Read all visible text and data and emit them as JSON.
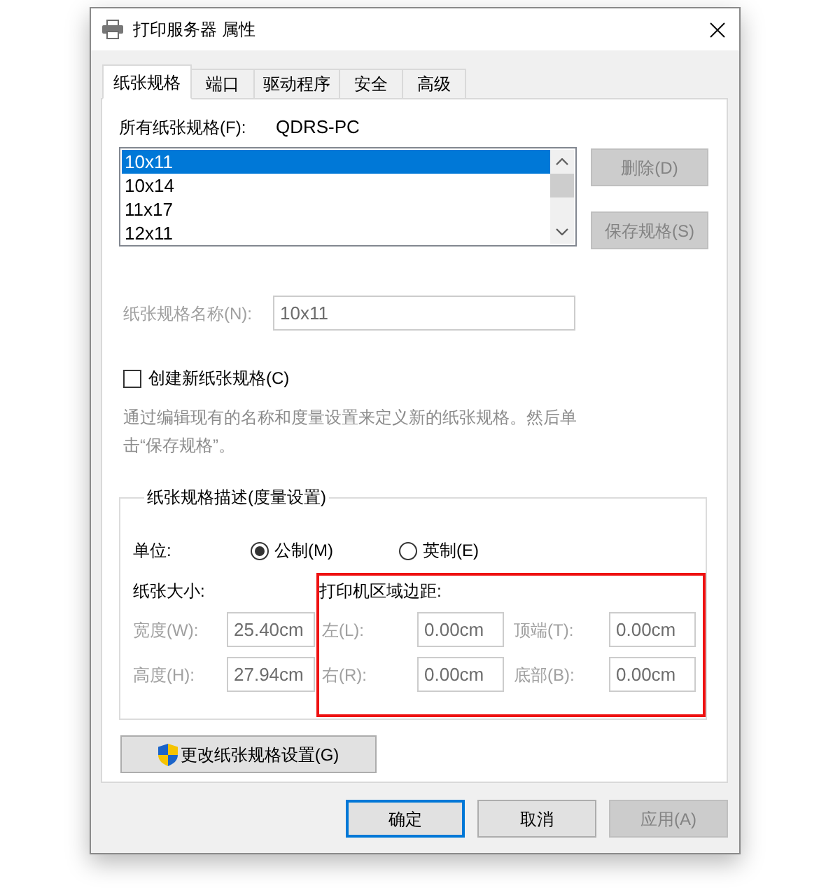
{
  "window": {
    "title": "打印服务器 属性"
  },
  "tabs": [
    {
      "label": "纸张规格",
      "selected": true
    },
    {
      "label": "端口",
      "selected": false
    },
    {
      "label": "驱动程序",
      "selected": false
    },
    {
      "label": "安全",
      "selected": false
    },
    {
      "label": "高级",
      "selected": false
    }
  ],
  "forms_list": {
    "label": "所有纸张规格(F):",
    "computer": "QDRS-PC",
    "items": [
      {
        "label": "10x11",
        "selected": true
      },
      {
        "label": "10x14",
        "selected": false
      },
      {
        "label": "11x17",
        "selected": false
      },
      {
        "label": "12x11",
        "selected": false
      }
    ]
  },
  "side_buttons": [
    {
      "label": "删除(D)",
      "disabled": true
    },
    {
      "label": "保存规格(S)",
      "disabled": true
    }
  ],
  "form_name": {
    "label": "纸张规格名称(N):",
    "value": "10x11",
    "disabled": true
  },
  "create_new_form": {
    "label": "创建新纸张规格(C)",
    "checked": false
  },
  "hint": {
    "text": "通过编辑现有的名称和度量设置来定义新的纸张规格。然后单击“保存规格”。",
    "disabled": true
  },
  "measurements": {
    "title": "纸张规格描述(度量设置)",
    "units": {
      "label": "单位:",
      "options": [
        {
          "label": "公制(M)",
          "selected": true
        },
        {
          "label": "英制(E)",
          "selected": false
        }
      ]
    },
    "paper_size": {
      "title": "纸张大小:",
      "fields": [
        {
          "label": "宽度(W):",
          "value": "25.40cm",
          "disabled": true
        },
        {
          "label": "高度(H):",
          "value": "27.94cm",
          "disabled": true
        }
      ]
    },
    "printer_margins": {
      "title": "打印机区域边距:",
      "highlighted": true,
      "fields": [
        {
          "label": "左(L):",
          "value": "0.00cm",
          "disabled": true
        },
        {
          "label": "顶端(T):",
          "value": "0.00cm",
          "disabled": true
        },
        {
          "label": "右(R):",
          "value": "0.00cm",
          "disabled": true
        },
        {
          "label": "底部(B):",
          "value": "0.00cm",
          "disabled": true
        }
      ]
    }
  },
  "change_settings_button": {
    "label": "更改纸张规格设置(G)"
  },
  "buttons": [
    {
      "label": "确定",
      "default": true,
      "disabled": false
    },
    {
      "label": "取消",
      "default": false,
      "disabled": false
    },
    {
      "label": "应用(A)",
      "default": false,
      "disabled": true
    }
  ]
}
